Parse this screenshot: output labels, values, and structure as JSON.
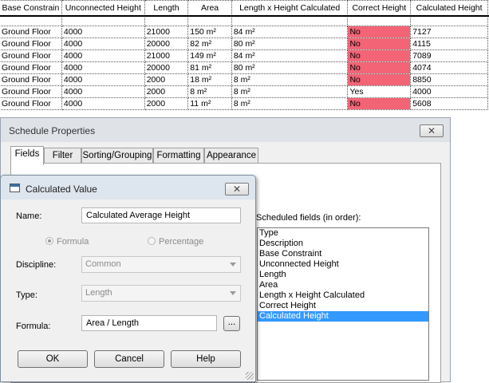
{
  "schedule": {
    "columns": [
      "Base Constrain",
      "Unconnected Height",
      "Length",
      "Area",
      "Length x Height Calculated",
      "Correct Height",
      "Calculated Height"
    ],
    "rows": [
      [
        "Ground Floor",
        "4000",
        "21000",
        "150 m²",
        "84 m²",
        "No",
        "7127"
      ],
      [
        "Ground Floor",
        "4000",
        "20000",
        "82 m²",
        "80 m²",
        "No",
        "4115"
      ],
      [
        "Ground Floor",
        "4000",
        "21000",
        "149 m²",
        "84 m²",
        "No",
        "7089"
      ],
      [
        "Ground Floor",
        "4000",
        "20000",
        "81 m²",
        "80 m²",
        "No",
        "4074"
      ],
      [
        "Ground Floor",
        "4000",
        "2000",
        "18 m²",
        "8 m²",
        "No",
        "8850"
      ],
      [
        "Ground Floor",
        "4000",
        "2000",
        "8 m²",
        "8 m²",
        "Yes",
        "4000"
      ],
      [
        "Ground Floor",
        "4000",
        "2000",
        "11 m²",
        "8 m²",
        "No",
        "5608"
      ]
    ],
    "highlight_color": "#f26476"
  },
  "schedule_properties": {
    "title": "Schedule Properties",
    "close_glyph": "✕",
    "tabs": [
      "Fields",
      "Filter",
      "Sorting/Grouping",
      "Formatting",
      "Appearance"
    ],
    "active_tab": "Fields",
    "scheduled_fields_label": "Scheduled fields (in order):",
    "scheduled_fields": [
      "Type",
      "Description",
      "Base Constraint",
      "Unconnected Height",
      "Length",
      "Area",
      "Length x Height Calculated",
      "Correct Height",
      "Calculated Height"
    ],
    "selected_field": "Calculated Height"
  },
  "calculated_value": {
    "title": "Calculated Value",
    "close_glyph": "✕",
    "name_label": "Name:",
    "name_value": "Calculated Average Height",
    "radio_formula": "Formula",
    "radio_percentage": "Percentage",
    "discipline_label": "Discipline:",
    "discipline_value": "Common",
    "type_label": "Type:",
    "type_value": "Length",
    "formula_label": "Formula:",
    "formula_value": "Area / Length",
    "browse_label": "...",
    "ok_label": "OK",
    "cancel_label": "Cancel",
    "help_label": "Help"
  }
}
